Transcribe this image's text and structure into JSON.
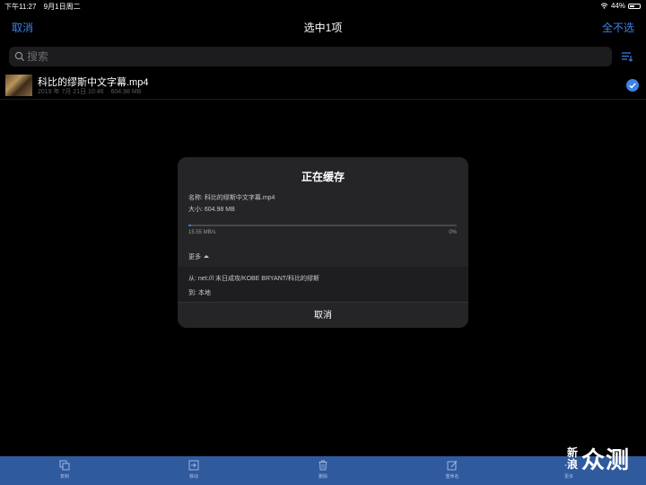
{
  "status_bar": {
    "time": "下午11:27",
    "date": "9月1日周二",
    "battery": "44%"
  },
  "navbar": {
    "cancel": "取消",
    "title": "选中1项",
    "deselect_all": "全不选"
  },
  "search": {
    "placeholder": "搜索"
  },
  "file": {
    "name": "科比的缪斯中文字幕.mp4",
    "date": "2019 年 7月 21日 10:46",
    "size": "604.98 MB",
    "selected": true
  },
  "dialog": {
    "title": "正在缓存",
    "name_line": "名称: 科比的缪斯中文字幕.mp4",
    "size_line": "大小: 604.98 MB",
    "progress": 0.01,
    "speed": "15.55 MB/s",
    "percent": "0%",
    "more": "更多",
    "from": "从: net://l  末日成攻/KOBE BRYANT/科比的缪斯",
    "to": "到: 本地",
    "cancel": "取消"
  },
  "toolbar": {
    "copy": "复制",
    "move": "移动",
    "delete": "删除",
    "rename": "重命名",
    "more": "更多"
  },
  "watermark": {
    "line1": "新",
    "line2": "浪",
    "brand": "众测"
  },
  "colors": {
    "accent": "#3d82e6",
    "toolbar_bg": "#2f5a9e",
    "dialog_bg": "#252527"
  }
}
